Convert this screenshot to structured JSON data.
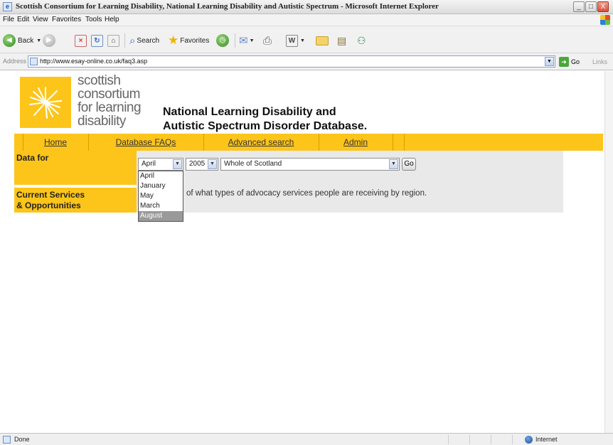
{
  "window": {
    "title": "Scottish Consortium for Learning Disability, National Learning Disability and Autistic Spectrum - Microsoft Internet Explorer",
    "minimize_glyph": "_",
    "maximize_glyph": "□",
    "close_glyph": "X"
  },
  "menu": [
    "File",
    "Edit",
    "View",
    "Favorites",
    "Tools",
    "Help"
  ],
  "toolbar": {
    "back": "Back",
    "search": "Search",
    "favorites": "Favorites"
  },
  "address": {
    "label": "Address",
    "url": "http://www.esay-online.co.uk/faq3.asp",
    "go": "Go",
    "links": "Links"
  },
  "site": {
    "logo_lines": [
      "scottish",
      "consortium",
      "for learning",
      "disability"
    ],
    "heading_line1": "National Learning Disability and",
    "heading_line2": "Autistic Spectrum Disorder Database."
  },
  "nav": [
    "Home",
    "Database FAQs",
    "Advanced search",
    "Admin"
  ],
  "form": {
    "data_for_label": "Data for",
    "month_value": "April",
    "year_value": "2005",
    "region_value": "Whole of Scotland",
    "go_label": "Go",
    "month_options": [
      "April",
      "January",
      "May",
      "March",
      "August"
    ],
    "highlighted_option": "August"
  },
  "section": {
    "label_line1": "Current Services",
    "label_line2": "& Opportunities",
    "description": "of what types of advocacy services people are receiving by region."
  },
  "status": {
    "text": "Done",
    "zone": "Internet"
  }
}
